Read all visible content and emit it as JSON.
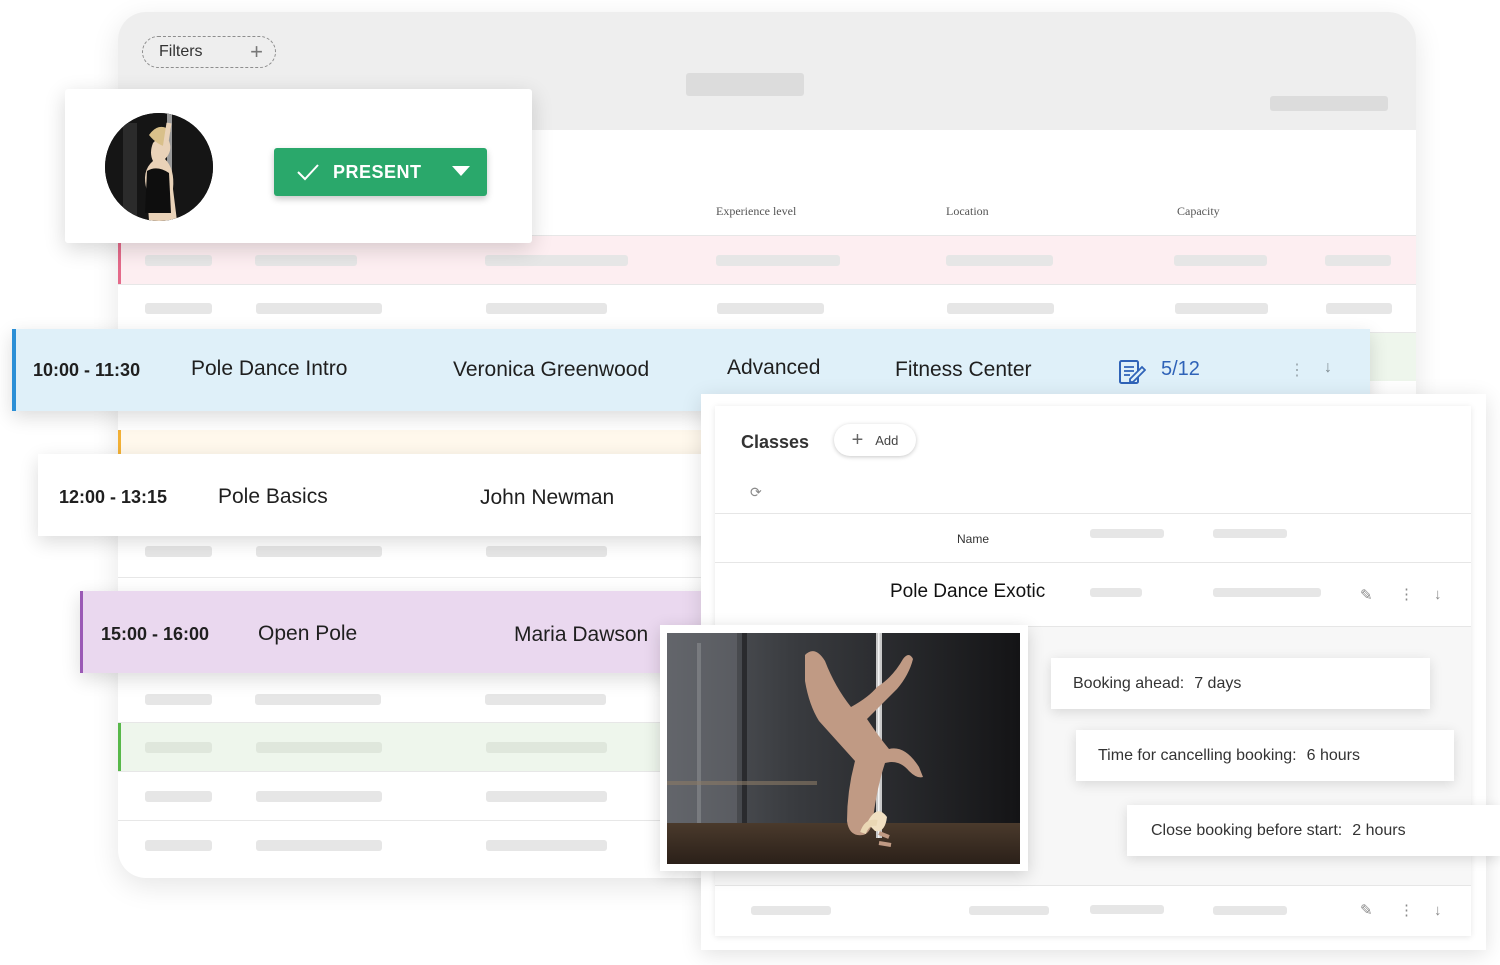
{
  "filters": {
    "label": "Filters",
    "add_symbol": "+"
  },
  "table": {
    "columns": [
      "Experience level",
      "Location",
      "Capacity"
    ]
  },
  "profile": {
    "present_label": "PRESENT",
    "check_icon": "check-icon",
    "dropdown_icon": "caret-down-icon"
  },
  "classes_list": [
    {
      "time": "10:00 - 11:30",
      "name": "Pole Dance Intro",
      "instructor": "Veronica Greenwood",
      "level": "Advanced",
      "location": "Fitness Center",
      "capacity": "5/12",
      "accent": "#2b8fd6"
    },
    {
      "time": "12:00 - 13:15",
      "name": "Pole Basics",
      "instructor": "John Newman"
    },
    {
      "time": "15:00 - 16:00",
      "name": "Open Pole",
      "instructor": "Maria Dawson",
      "accent": "#9a59b5"
    }
  ],
  "classes_panel": {
    "title": "Classes",
    "add_label": "Add",
    "name_header": "Name",
    "row_name": "Pole Dance Exotic"
  },
  "booking": {
    "ahead_label": "Booking ahead:",
    "ahead_value": "7 days",
    "cancel_label": "Time for cancelling booking:",
    "cancel_value": "6 hours",
    "close_label": "Close booking before start:",
    "close_value": "2 hours"
  },
  "colors": {
    "present_green": "#2aa86b",
    "row_blue": "#dff0f9",
    "row_purple": "#ead8ef",
    "row_pink": "#fdeef1",
    "row_green": "#eef6ec",
    "capacity_blue": "#2f63b8"
  }
}
